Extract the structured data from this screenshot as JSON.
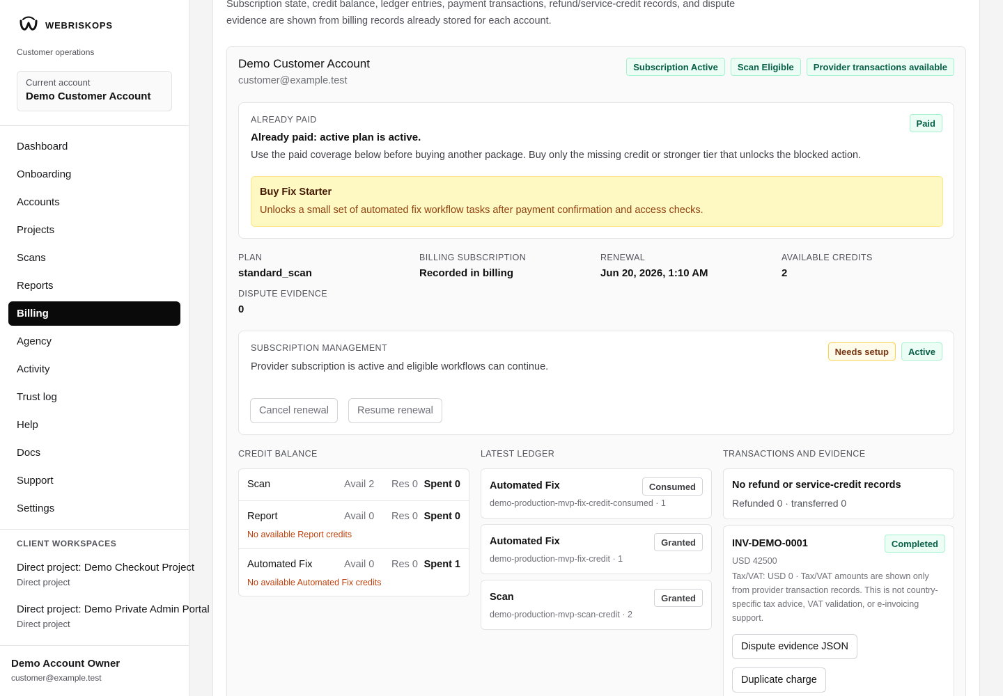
{
  "brand": {
    "name": "WEBRISKOPS",
    "subtitle": "Customer operations"
  },
  "current_account": {
    "label": "Current account",
    "value": "Demo Customer Account"
  },
  "nav": [
    {
      "label": "Dashboard",
      "active": false
    },
    {
      "label": "Onboarding",
      "active": false
    },
    {
      "label": "Accounts",
      "active": false
    },
    {
      "label": "Projects",
      "active": false
    },
    {
      "label": "Scans",
      "active": false
    },
    {
      "label": "Reports",
      "active": false
    },
    {
      "label": "Billing",
      "active": true
    },
    {
      "label": "Agency",
      "active": false
    },
    {
      "label": "Activity",
      "active": false
    },
    {
      "label": "Trust log",
      "active": false
    },
    {
      "label": "Help",
      "active": false
    },
    {
      "label": "Docs",
      "active": false
    },
    {
      "label": "Support",
      "active": false
    },
    {
      "label": "Settings",
      "active": false
    }
  ],
  "workspaces": {
    "title": "CLIENT WORKSPACES",
    "items": [
      {
        "title": "Direct project: Demo Checkout Project",
        "subtitle": "Direct project"
      },
      {
        "title": "Direct project: Demo Private Admin Portal",
        "subtitle": "Direct project"
      }
    ]
  },
  "owner": {
    "name": "Demo Account Owner",
    "email": "customer@example.test"
  },
  "intro": "Subscription state, credit balance, ledger entries, payment transactions, refund/service-credit records, and dispute evidence are shown from billing records already stored for each account.",
  "account": {
    "title": "Demo Customer Account",
    "email": "customer@example.test",
    "badges": [
      "Subscription Active",
      "Scan Eligible",
      "Provider transactions available"
    ]
  },
  "already_paid": {
    "eyebrow": "ALREADY PAID",
    "badge": "Paid",
    "headline": "Already paid: active plan is active.",
    "description": "Use the paid coverage below before buying another package. Buy only the missing credit or stronger tier that unlocks the blocked action.",
    "notice_title": "Buy Fix Starter",
    "notice_text": "Unlocks a small set of automated fix workflow tasks after payment confirmation and access checks."
  },
  "stats": [
    {
      "key": "PLAN",
      "value": "standard_scan"
    },
    {
      "key": "BILLING SUBSCRIPTION",
      "value": "Recorded in billing"
    },
    {
      "key": "RENEWAL",
      "value": "Jun 20, 2026, 1:10 AM"
    },
    {
      "key": "AVAILABLE CREDITS",
      "value": "2"
    },
    {
      "key": "DISPUTE EVIDENCE",
      "value": "0"
    }
  ],
  "subscription": {
    "eyebrow": "SUBSCRIPTION MANAGEMENT",
    "badges": [
      "Needs setup",
      "Active"
    ],
    "description": "Provider subscription is active and eligible workflows can continue.",
    "cancel_label": "Cancel renewal",
    "resume_label": "Resume renewal"
  },
  "credit_balance": {
    "title": "CREDIT BALANCE",
    "rows": [
      {
        "name": "Scan",
        "avail": "Avail 2",
        "res": "Res 0",
        "spent": "Spent 0",
        "warning": ""
      },
      {
        "name": "Report",
        "avail": "Avail 0",
        "res": "Res 0",
        "spent": "Spent 0",
        "warning": "No available Report credits"
      },
      {
        "name": "Automated Fix",
        "avail": "Avail 0",
        "res": "Res 0",
        "spent": "Spent 1",
        "warning": "No available Automated Fix credits"
      }
    ]
  },
  "ledger": {
    "title": "LATEST LEDGER",
    "entries": [
      {
        "title": "Automated Fix",
        "badge": "Consumed",
        "detail": "demo-production-mvp-fix-credit-consumed · 1"
      },
      {
        "title": "Automated Fix",
        "badge": "Granted",
        "detail": "demo-production-mvp-fix-credit · 1"
      },
      {
        "title": "Scan",
        "badge": "Granted",
        "detail": "demo-production-mvp-scan-credit · 2"
      }
    ]
  },
  "transactions": {
    "title": "TRANSACTIONS AND EVIDENCE",
    "refund_title": "No refund or service-credit records",
    "refund_detail": "Refunded 0 · transferred 0",
    "invoice_id": "INV-DEMO-0001",
    "invoice_status": "Completed",
    "invoice_amount": "USD 42500",
    "invoice_tax_note": "Tax/VAT: USD 0 · Tax/VAT amounts are shown only from provider transaction records. This is not country-specific tax advice, VAT validation, or e-invoicing support.",
    "dispute_button": "Dispute evidence JSON",
    "duplicate_button": "Duplicate charge"
  }
}
